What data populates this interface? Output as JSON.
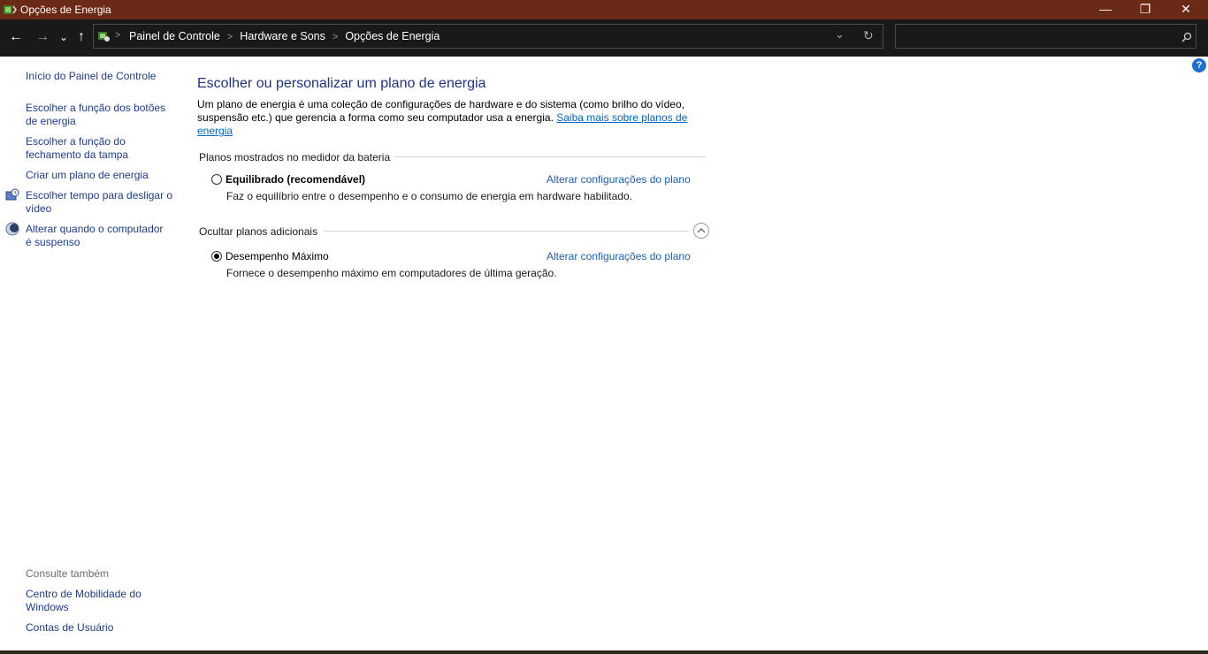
{
  "window": {
    "title": "Opções de Energia",
    "minimize_glyph": "—",
    "restore_glyph": "❐",
    "close_glyph": "✕"
  },
  "nav": {
    "back_glyph": "←",
    "forward_glyph": "→",
    "recent_glyph": "⌄",
    "up_glyph": "↑",
    "refresh_glyph": "↻",
    "dropdown_glyph": "⌄",
    "breadcrumbs": [
      "Painel de Controle",
      "Hardware e Sons",
      "Opções de Energia"
    ],
    "search_value": ""
  },
  "sidebar": {
    "home": "Início do Painel de Controle",
    "items": [
      {
        "label_line1": "Escolher a função dos botões",
        "label_line2": "de energia",
        "icon": ""
      },
      {
        "label_line1": "Escolher a função do",
        "label_line2": "fechamento da tampa",
        "icon": ""
      },
      {
        "label_line1": "Criar um plano de energia",
        "label_line2": "",
        "icon": ""
      },
      {
        "label_line1": "Escolher tempo para desligar o",
        "label_line2": "vídeo",
        "icon": "clock-monitor-icon"
      },
      {
        "label_line1": "Alterar quando o computador",
        "label_line2": "é suspenso",
        "icon": "moon-icon"
      }
    ],
    "see_also_title": "Consulte também",
    "see_also": [
      {
        "label_line1": "Centro de Mobilidade do",
        "label_line2": "Windows"
      },
      {
        "label_line1": "Contas de Usuário",
        "label_line2": ""
      }
    ]
  },
  "main": {
    "title": "Escolher ou personalizar um plano de energia",
    "description_line1": "Um plano de energia é uma coleção de configurações de hardware e do sistema (como brilho do vídeo,",
    "description_line2": "suspensão etc.) que gerencia a forma como seu computador usa a energia. ",
    "learn_more_link": "Saiba mais sobre planos de energia",
    "group1_header": "Planos mostrados no medidor da bateria",
    "plan1": {
      "name": "Equilibrado (recomendável)",
      "selected": false,
      "description": "Faz o equilíbrio entre o desempenho e o consumo de energia em hardware habilitado.",
      "link": "Alterar configurações do plano"
    },
    "group2_header": "Ocultar planos adicionais",
    "plan2": {
      "name": "Desempenho Máximo",
      "selected": true,
      "description": "Fornece o desempenho máximo em computadores de última geração.",
      "link": "Alterar configurações do plano"
    },
    "help_glyph": "?"
  },
  "colors": {
    "titlebar": "#6b2a17",
    "navbar": "#191919",
    "link": "#1a5fb4",
    "heading": "#1e3287"
  }
}
